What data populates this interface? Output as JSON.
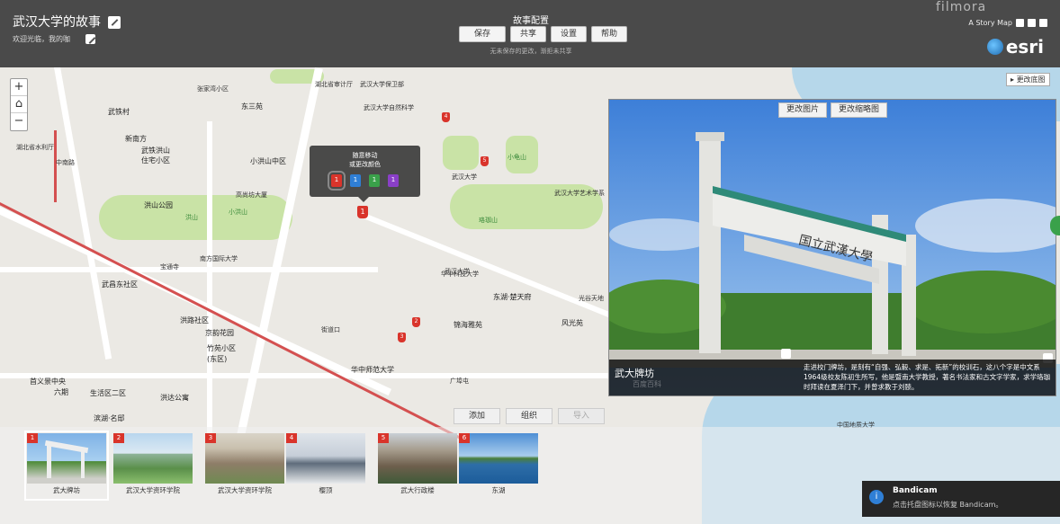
{
  "header": {
    "title": "武汉大学的故事",
    "subtitle": "欢迎光临，我的咖",
    "config_title": "故事配置",
    "buttons": {
      "save": "保存",
      "share": "共享",
      "settings": "设置",
      "help": "帮助"
    },
    "unsaved_note": "无未保存的更改，渐拒未共享",
    "storymap_label": "A Story Map",
    "esri_logo": "esri",
    "watermark": "filmora"
  },
  "map": {
    "change_basemap": "更改底图",
    "zoom": {
      "in": "+",
      "home": "⌂",
      "out": "−"
    },
    "labels": [
      "张家湾小区",
      "湖北省审计厅",
      "武汉大学保卫部",
      "武铁村",
      "东三苑",
      "武汉大学自然科学",
      "新南方",
      "中南路",
      "武铁洪山",
      "住宅小区",
      "小洪山中区",
      "武汉大学",
      "小龟山",
      "湖北省水利厅",
      "洪山公园",
      "洪山",
      "小洪山",
      "高尚坊大厦",
      "华中科技大学",
      "武汉大学艺术学系",
      "珞珈山",
      "宝通寺",
      "南方国际大学",
      "武昌东社区",
      "武汉大学",
      "东湖·楚天府",
      "光谷天地",
      "洪路社区",
      "京韵花园",
      "竹苑小区",
      "(东区)",
      "街道口",
      "锦海雅苑",
      "风光苑",
      "华中师范大学",
      "广埠屯",
      "首义景中央",
      "生活区二区",
      "洪达公寓",
      "滨湖·名邸",
      "中国地质大学",
      "六期"
    ],
    "pins": [
      "4",
      "5",
      "1",
      "2",
      "3"
    ],
    "popup": {
      "line1": "随意移动",
      "line2": "或更改颜色",
      "colors": [
        "1",
        "1",
        "1",
        "1"
      ]
    }
  },
  "media": {
    "buttons": {
      "change_image": "更改图片",
      "change_thumb": "更改缩略图"
    },
    "gate_text": "国立武漢大學",
    "caption_title": "武大牌坊",
    "caption_desc": "走进校门牌坊，是刻有“自强、弘毅、求是、拓新”的校训石，这八个字是中文系1964级校友陈初生所写，他是暨南大学教授，著名书法家和古文字学家，求学珞珈时拜读在夏泽门下，并曾求教于刘赜。",
    "watermark": "百度百科"
  },
  "actions": {
    "add": "添加",
    "organize": "组织",
    "import": "导入"
  },
  "carousel": [
    {
      "num": "1",
      "label": "武大牌坊"
    },
    {
      "num": "2",
      "label": "武汉大学资环学院"
    },
    {
      "num": "3",
      "label": "武汉大学资环学院"
    },
    {
      "num": "4",
      "label": "樱顶"
    },
    {
      "num": "5",
      "label": "武大行政楼"
    },
    {
      "num": "6",
      "label": "东湖"
    }
  ],
  "toast": {
    "title": "Bandicam",
    "message": "点击托盘图标以恢复 Bandicam。"
  },
  "colors": {
    "header_bg": "#4a4a4a",
    "pin_red": "#d9342b",
    "park_green": "#c9e3a6"
  }
}
